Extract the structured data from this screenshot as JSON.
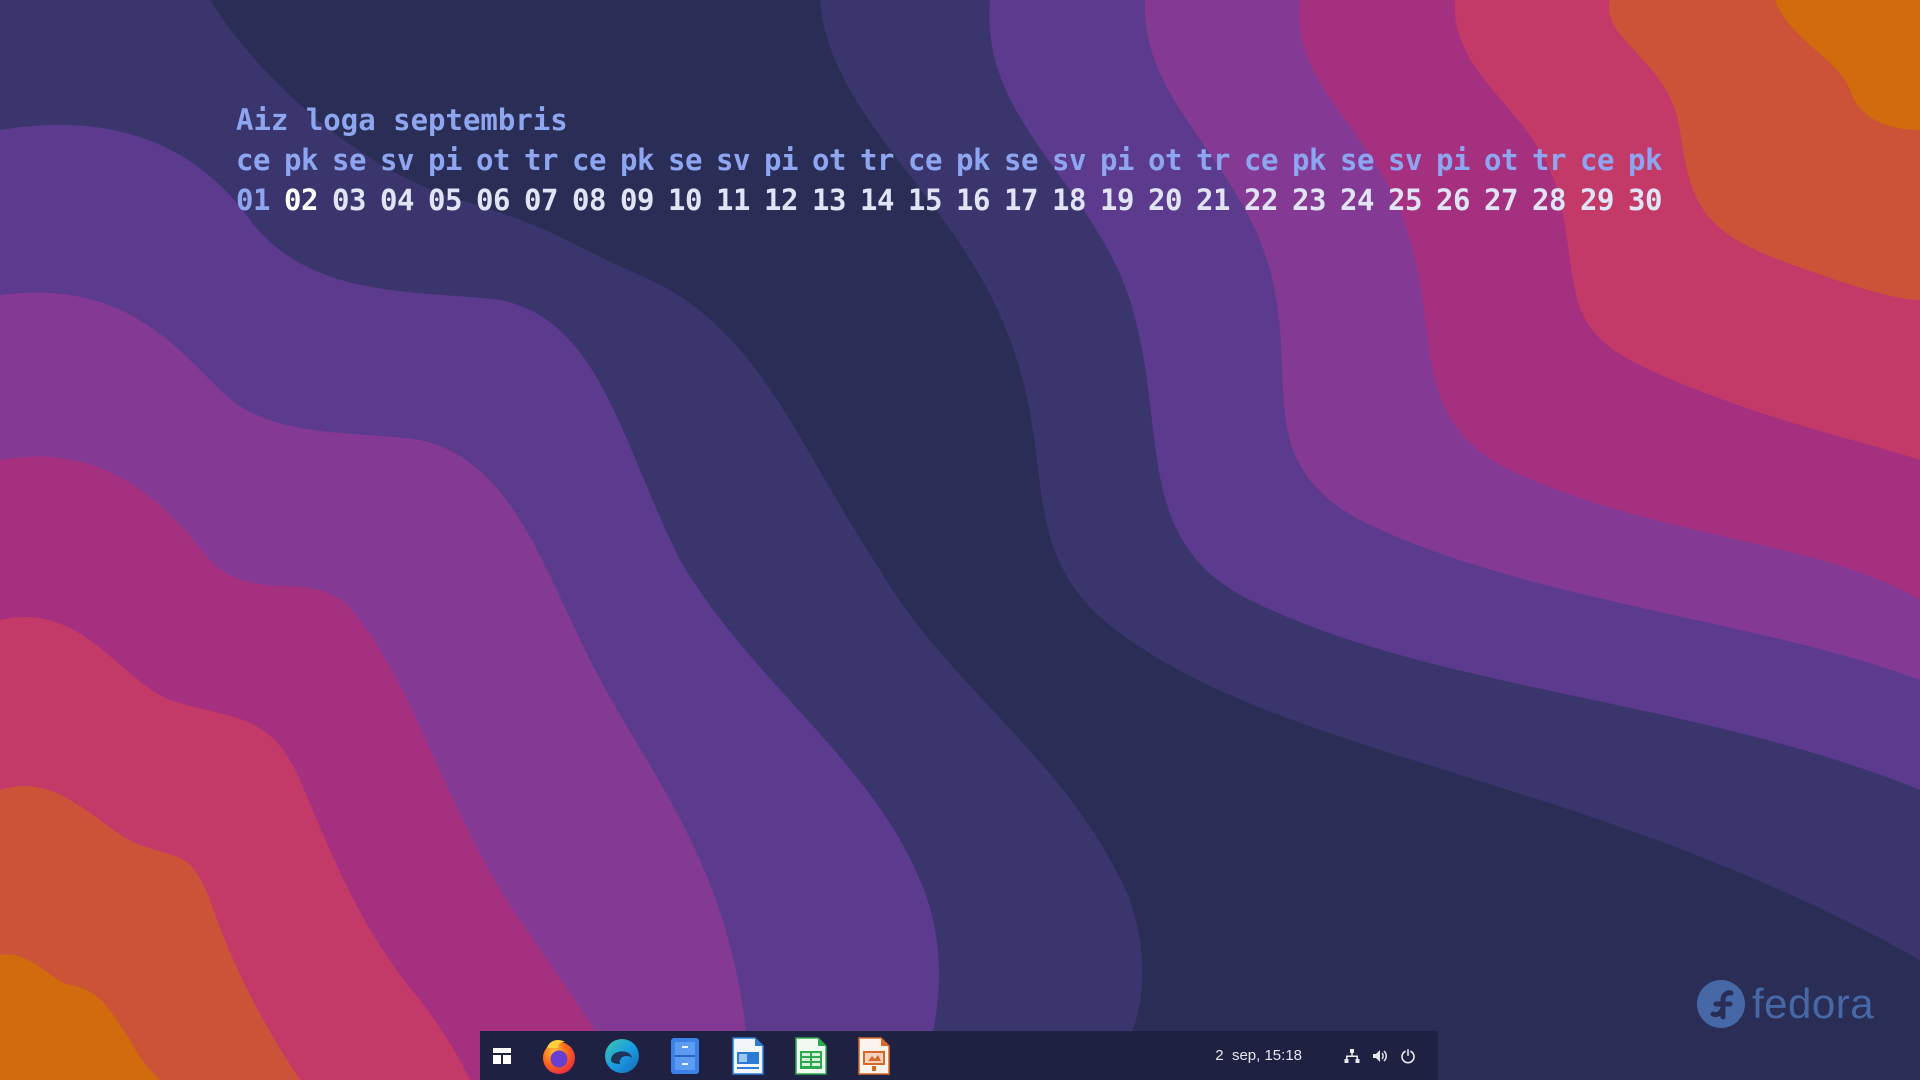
{
  "calendar": {
    "title": "Aiz loga septembris",
    "weekdays": [
      "ce",
      "pk",
      "se",
      "sv",
      "pi",
      "ot",
      "tr",
      "ce",
      "pk",
      "se",
      "sv",
      "pi",
      "ot",
      "tr",
      "ce",
      "pk",
      "se",
      "sv",
      "pi",
      "ot",
      "tr",
      "ce",
      "pk",
      "se",
      "sv",
      "pi",
      "ot",
      "tr",
      "ce",
      "pk"
    ],
    "days": [
      "01",
      "02",
      "03",
      "04",
      "05",
      "06",
      "07",
      "08",
      "09",
      "10",
      "11",
      "12",
      "13",
      "14",
      "15",
      "16",
      "17",
      "18",
      "19",
      "20",
      "21",
      "22",
      "23",
      "24",
      "25",
      "26",
      "27",
      "28",
      "29",
      "30"
    ],
    "today_index": 1,
    "colors": {
      "header": "#8ea6f0",
      "day": "#e0e4f4",
      "today": "#ffffff"
    }
  },
  "taskbar": {
    "clock": "2  sep, 15:18",
    "launchers": [
      {
        "name": "activities",
        "icon": "activities-icon"
      },
      {
        "name": "firefox",
        "icon": "firefox-icon"
      },
      {
        "name": "edge",
        "icon": "edge-icon"
      },
      {
        "name": "file-manager",
        "icon": "file-manager-icon"
      },
      {
        "name": "writer",
        "icon": "writer-icon"
      },
      {
        "name": "calc",
        "icon": "calc-icon"
      },
      {
        "name": "impress",
        "icon": "impress-icon"
      }
    ],
    "tray": [
      "network-icon",
      "volume-icon",
      "power-icon"
    ]
  },
  "branding": {
    "wordmark": "fedora"
  }
}
